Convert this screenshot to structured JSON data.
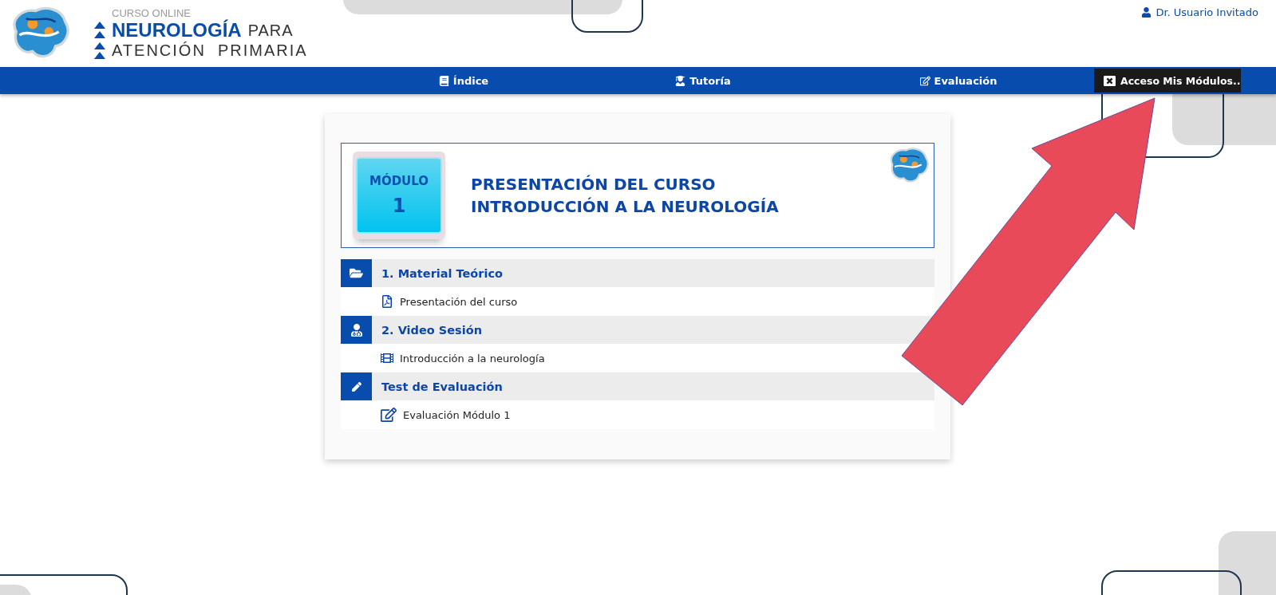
{
  "header": {
    "kicker": "CURSO ONLINE",
    "title_strong": "NEUROLOGÍA",
    "title_rest": "PARA",
    "subtitle": "ATENCIÓN  PRIMARIA",
    "user": "Dr. Usuario Invitado"
  },
  "nav": {
    "items": [
      {
        "label": "Índice",
        "kind": "book"
      },
      {
        "label": "Tutoría",
        "kind": "tutor"
      },
      {
        "label": "Evaluación",
        "kind": "edit"
      }
    ],
    "access_button": "Acceso Mis Módulos.."
  },
  "module": {
    "badge_label": "MÓDULO",
    "badge_number": "1",
    "title_lines": [
      "PRESENTACIÓN DEL CURSO",
      "INTRODUCCIÓN A LA NEUROLOGÍA"
    ]
  },
  "sections": [
    {
      "title": "1. Material Teórico",
      "kind": "folder",
      "items": [
        {
          "label": "Presentación del curso",
          "kind": "pdf"
        }
      ]
    },
    {
      "title": "2. Video Sesión",
      "kind": "doctor",
      "items": [
        {
          "label": "Introducción a la neurología",
          "kind": "film"
        }
      ]
    },
    {
      "title": "Test de Evaluación",
      "kind": "pencil",
      "items": [
        {
          "label": "Evaluación Módulo 1",
          "kind": "edit"
        }
      ]
    }
  ]
}
